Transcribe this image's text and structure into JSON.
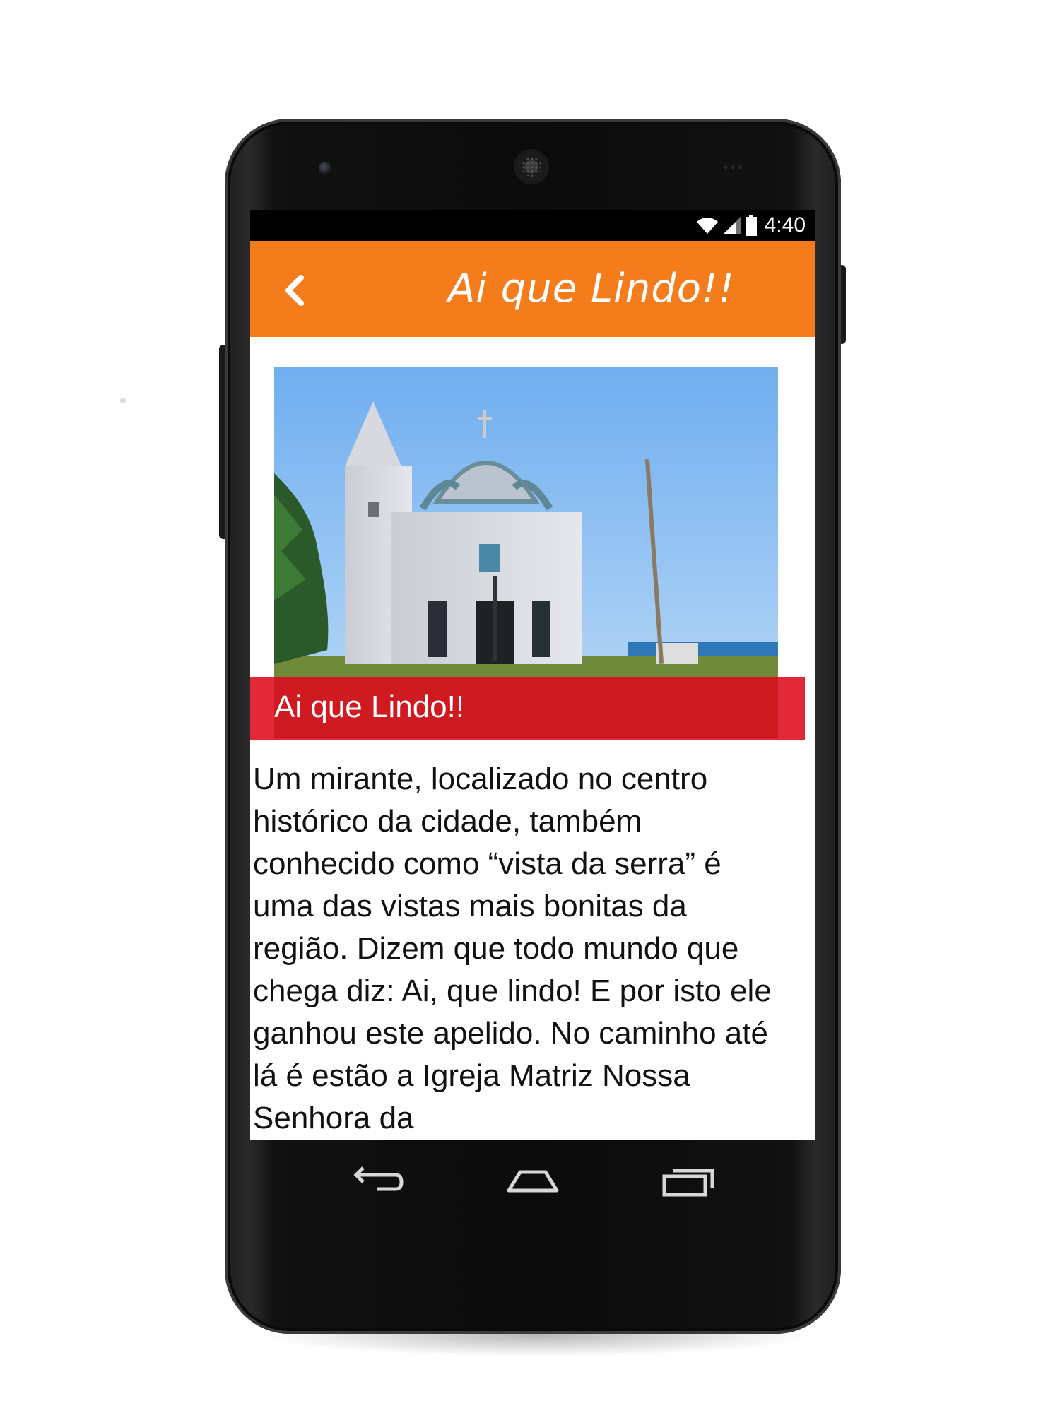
{
  "status_bar": {
    "time": "4:40",
    "icons": [
      "wifi-icon",
      "signal-icon",
      "battery-icon"
    ]
  },
  "app_bar": {
    "title": "Ai que Lindo!!",
    "back_icon": "chevron-left-icon",
    "color": "#f57c1b"
  },
  "hero": {
    "caption": "Ai que Lindo!!",
    "caption_color": "#de0a1e"
  },
  "description": "Um mirante, localizado no centro histórico da cidade, também conhecido como “vista da serra” é uma das vistas mais bonitas da região. Dizem que todo mundo que chega diz: Ai, que lindo! E por isto ele ganhou este apelido. No caminho até lá é estão a Igreja Matriz Nossa Senhora da",
  "nav_bar": {
    "buttons": [
      "back-icon",
      "home-icon",
      "recent-apps-icon"
    ]
  }
}
